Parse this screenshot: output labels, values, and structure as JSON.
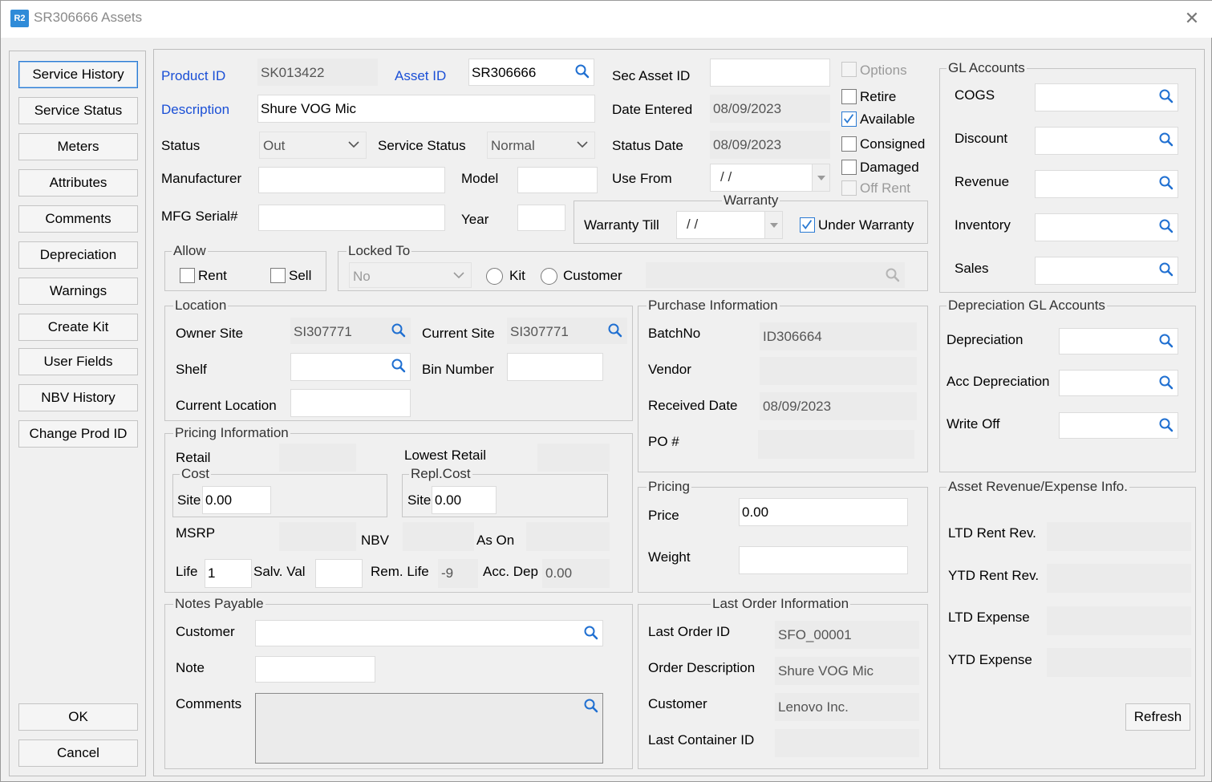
{
  "window": {
    "app_icon": "R2",
    "title": "SR306666 Assets",
    "close_label": "✕"
  },
  "sidebar": {
    "buttons": [
      "Service History",
      "Service Status",
      "Meters",
      "Attributes",
      "Comments",
      "Depreciation",
      "Warnings",
      "Create Kit",
      "User Fields",
      "NBV History",
      "Change Prod ID"
    ],
    "ok": "OK",
    "cancel": "Cancel"
  },
  "header": {
    "product_id_label": "Product ID",
    "product_id": "SK013422",
    "asset_id_label": "Asset ID",
    "asset_id": "SR306666",
    "sec_asset_id_label": "Sec Asset ID",
    "sec_asset_id": "",
    "description_label": "Description",
    "description": "Shure VOG Mic",
    "date_entered_label": "Date Entered",
    "date_entered": "08/09/2023",
    "status_label": "Status",
    "status": "Out",
    "service_status_label": "Service Status",
    "service_status": "Normal",
    "status_date_label": "Status Date",
    "status_date": "08/09/2023",
    "manufacturer_label": "Manufacturer",
    "manufacturer": "",
    "model_label": "Model",
    "model": "",
    "use_from_label": "Use From",
    "use_from": "/ /",
    "mfg_serial_label": "MFG Serial#",
    "mfg_serial": "",
    "year_label": "Year",
    "year": ""
  },
  "flags": {
    "options": "Options",
    "retire": "Retire",
    "available": "Available",
    "consigned": "Consigned",
    "damaged": "Damaged",
    "off_rent": "Off Rent"
  },
  "warranty": {
    "title": "Warranty",
    "till_label": "Warranty Till",
    "till": "/ /",
    "under_warranty": "Under Warranty"
  },
  "allow": {
    "title": "Allow",
    "rent": "Rent",
    "sell": "Sell"
  },
  "locked_to": {
    "title": "Locked To",
    "value": "No",
    "kit": "Kit",
    "customer": "Customer"
  },
  "location": {
    "title": "Location",
    "owner_site_label": "Owner Site",
    "owner_site": "SI307771",
    "current_site_label": "Current Site",
    "current_site": "SI307771",
    "shelf_label": "Shelf",
    "shelf": "",
    "bin_number_label": "Bin Number",
    "bin_number": "",
    "current_location_label": "Current Location",
    "current_location": ""
  },
  "purchase": {
    "title": "Purchase Information",
    "batch_label": "BatchNo",
    "batch": "ID306664",
    "vendor_label": "Vendor",
    "vendor": "",
    "received_label": "Received Date",
    "received": "08/09/2023",
    "po_label": "PO #",
    "po": ""
  },
  "pricing_info": {
    "title": "Pricing Information",
    "retail_label": "Retail",
    "retail": "",
    "lowest_retail_label": "Lowest Retail",
    "lowest_retail": "",
    "cost_title": "Cost",
    "cost_site_label": "Site",
    "cost_site": "0.00",
    "repl_title": "Repl.Cost",
    "repl_site_label": "Site",
    "repl_site": "0.00",
    "msrp_label": "MSRP",
    "msrp": "",
    "nbv_label": "NBV",
    "nbv": "",
    "as_on_label": "As On",
    "as_on": "",
    "life_label": "Life",
    "life": "1",
    "salv_label": "Salv. Val",
    "salv": "",
    "rem_life_label": "Rem. Life",
    "rem_life": "-9",
    "acc_dep_label": "Acc. Dep",
    "acc_dep": "0.00"
  },
  "pricing": {
    "title": "Pricing",
    "price_label": "Price",
    "price": "0.00",
    "weight_label": "Weight",
    "weight": ""
  },
  "notes": {
    "title": "Notes Payable",
    "customer_label": "Customer",
    "customer": "",
    "note_label": "Note",
    "note": "",
    "comments_label": "Comments",
    "comments": ""
  },
  "last_order": {
    "title": "Last Order Information",
    "id_label": "Last Order ID",
    "id": "SFO_00001",
    "desc_label": "Order Description",
    "desc": "Shure VOG Mic",
    "customer_label": "Customer",
    "customer": "Lenovo Inc.",
    "container_label": "Last Container ID",
    "container": ""
  },
  "gl": {
    "title": "GL Accounts",
    "labels": [
      "COGS",
      "Discount",
      "Revenue",
      "Inventory",
      "Sales"
    ]
  },
  "dep_gl": {
    "title": "Depreciation GL Accounts",
    "labels": [
      "Depreciation",
      "Acc Depreciation",
      "Write Off"
    ]
  },
  "rev_exp": {
    "title": "Asset Revenue/Expense Info.",
    "ltd_rent_label": "LTD Rent Rev.",
    "ytd_rent_label": "YTD Rent Rev.",
    "ltd_exp_label": "LTD Expense",
    "ytd_exp_label": "YTD Expense",
    "refresh": "Refresh"
  },
  "colors": {
    "link_blue": "#1a4fd6",
    "accent": "#2a7ad3"
  },
  "icons": {
    "search": "search-icon",
    "dropdown": "chevron-down-icon",
    "check": "checkmark-icon"
  }
}
